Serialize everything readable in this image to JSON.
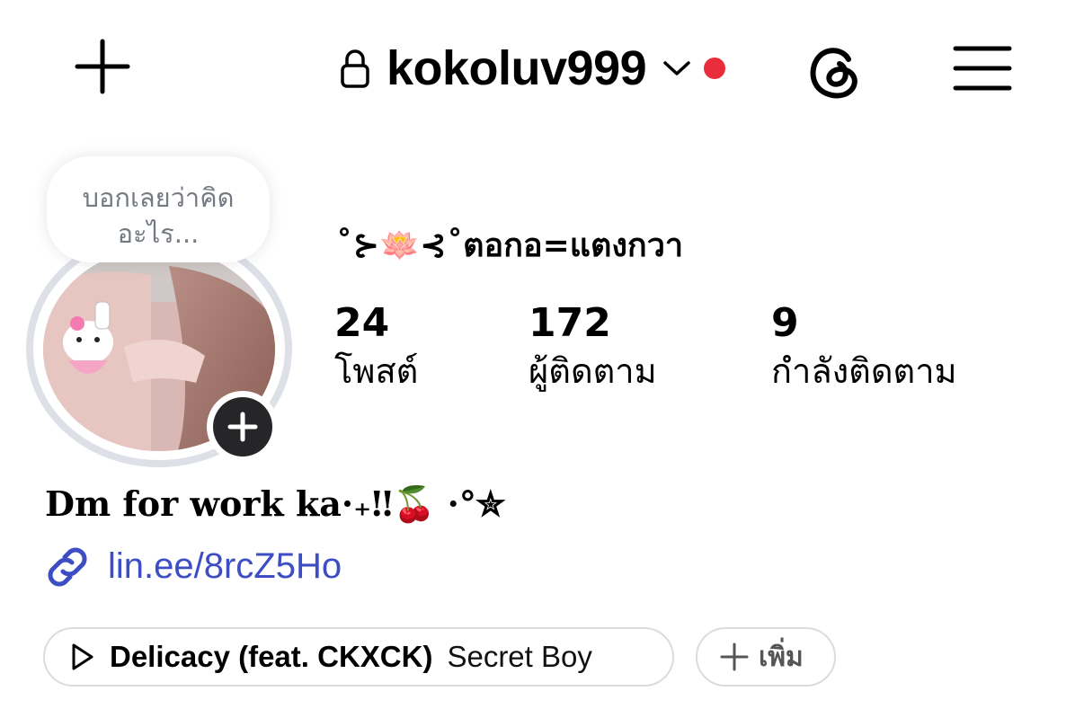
{
  "header": {
    "username": "kokoluv999",
    "icons": {
      "create": "plus-icon",
      "lock": "lock-icon",
      "switch": "chevron-down-icon",
      "threads": "threads-icon",
      "menu": "hamburger-menu-icon"
    },
    "notification_dot_color": "#ea2d3c"
  },
  "note": {
    "line1": "บอกเลยว่าคิด",
    "line2": "อะไร..."
  },
  "profile": {
    "display_name": "˚⊱🪷⊰˚ตอกอ=แตงกวา",
    "stats": [
      {
        "value": "24",
        "label": "โพสต์"
      },
      {
        "value": "172",
        "label": "ผู้ติดตาม"
      },
      {
        "value": "9",
        "label": "กำลังติดตาม"
      }
    ],
    "bio": "Dm for work ka·₊‼🍒 ·°✮",
    "link": "lin.ee/8rcZ5Ho",
    "link_color": "#3d4ec4"
  },
  "chips": {
    "music": {
      "song": "Delicacy (feat. CKXCK)",
      "artist": "Secret Boy",
      "icon": "play-icon"
    },
    "add": {
      "label": "เพิ่ม",
      "icon": "plus-icon"
    }
  }
}
